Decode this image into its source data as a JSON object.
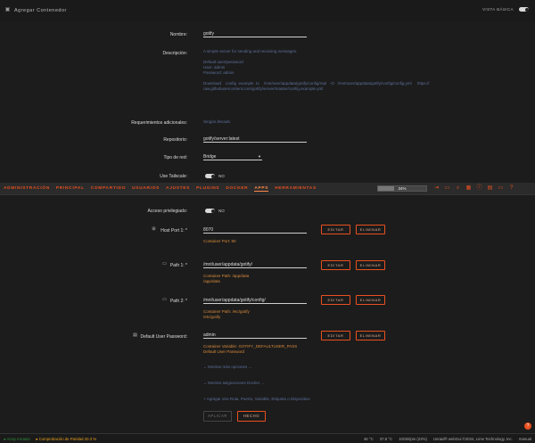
{
  "titlebar": {
    "title": "Agregar Contenedor",
    "view_label": "VISTA BÁSICA"
  },
  "form": {
    "name_label": "Nombre:",
    "name_value": "gotify",
    "desc_label": "Descripción:",
    "desc_lines": [
      "A simple server for sending and receiving messages.",
      "",
      "Default user/password",
      "User: admin",
      "Password: admin",
      "",
      "Download    config  example  to    /mnt/user/appdata/gotify/config/repl   -O   /mnt/user/appdata/gotify/config/config.yml     https://",
      "raw.githubusercontent.com/gotify/server/master/config.example.yml"
    ],
    "req_label": "Requerimientos adicionales:",
    "req_value": "Ningún llenado",
    "repo_label": "Repositorio:",
    "repo_value": "gotify/server:latest",
    "net_label": "Tipo de red:",
    "net_value": "Bridge",
    "tailscale_label": "Use Tailscale:",
    "tailscale_value": "NO",
    "priv_label": "Acceso privilegiado:",
    "priv_value": "NO",
    "host_port_label": "Host Port 1: *",
    "host_port_value": "8070",
    "host_port_help": "Container Port: 80",
    "path1_label": "Path 1: *",
    "path1_value": "/mnt/user/appdata/gotify/",
    "path1_help": [
      "Container Path: /app/data",
      "/app/data"
    ],
    "path2_label": "Path 2: *",
    "path2_value": "/mnt/user/appdata/gotify/config/",
    "path2_help": [
      "Container Path: /etc/gotify",
      "/etc/gotify"
    ],
    "pass_label": "Default User Password:",
    "pass_value": "admin",
    "pass_help": [
      "Container Variable: GOTIFY_DEFAULTUSER_PASS",
      "Default User Password"
    ],
    "show_more": "Mostrar más opciones ...",
    "show_docker": "Mostrar asignaciones Docker ...",
    "add_more": "Agregar otra Ruta, Puerto, Variable, Etiqueta o Dispositivo",
    "edit_label": "EDITAR",
    "delete_label": "ELIMINAR",
    "apply_label": "APLICAR",
    "done_label": "HECHO"
  },
  "nav": {
    "tabs": [
      "ADMINISTRACIÓN",
      "PRINCIPAL",
      "COMPARTIDO",
      "USUARIOS",
      "AJUSTES",
      "PLUGINS",
      "DOCKER",
      "APPS",
      "HERRAMIENTAS"
    ],
    "active_tab": "APPS",
    "progress_text": "34%",
    "progress_fraction": 0.34,
    "icons": [
      "logout-icon",
      "terminal-icon",
      "search-icon",
      "grid-icon",
      "info-icon",
      "notes-icon",
      "monitor-icon",
      "help-icon"
    ]
  },
  "status": {
    "array_state": "Array Iniciado",
    "parity_state": "Comprobación de Paridad 20.3 %",
    "temp1": "46 °C",
    "temp2": "37.8 °C",
    "mem": "10GiB/pm (22%)",
    "copyright": "Unraid® webGui ©2024, Lime Technology, Inc.",
    "manual": "manual"
  },
  "colors": {
    "accent": "#e8501f",
    "help_text": "#5c6f9a",
    "array_green": "#2d8a3a",
    "parity_orange": "#e8a020"
  }
}
